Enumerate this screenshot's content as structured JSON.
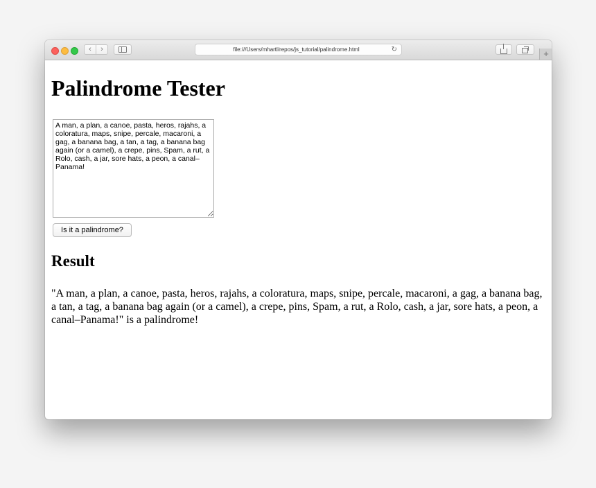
{
  "browser": {
    "url": "file:///Users/mhartl/repos/js_tutorial/palindrome.html",
    "new_tab_label": "+"
  },
  "page": {
    "title": "Palindrome Tester",
    "textarea_value": "A man, a plan, a canoe, pasta, heros, rajahs, a coloratura, maps, snipe, percale, macaroni, a gag, a banana bag, a tan, a tag, a banana bag again (or a camel), a crepe, pins, Spam, a rut, a Rolo, cash, a jar, sore hats, a peon, a canal–Panama!",
    "button_label": "Is it a palindrome?",
    "result_heading": "Result",
    "result_text": "\"A man, a plan, a canoe, pasta, heros, rajahs, a coloratura, maps, snipe, percale, macaroni, a gag, a banana bag, a tan, a tag, a banana bag again (or a camel), a crepe, pins, Spam, a rut, a Rolo, cash, a jar, sore hats, a peon, a canal–Panama!\" is a palindrome!"
  },
  "colors": {
    "close": "#fc615d",
    "minimize": "#fdbc40",
    "zoom": "#34c84a"
  }
}
